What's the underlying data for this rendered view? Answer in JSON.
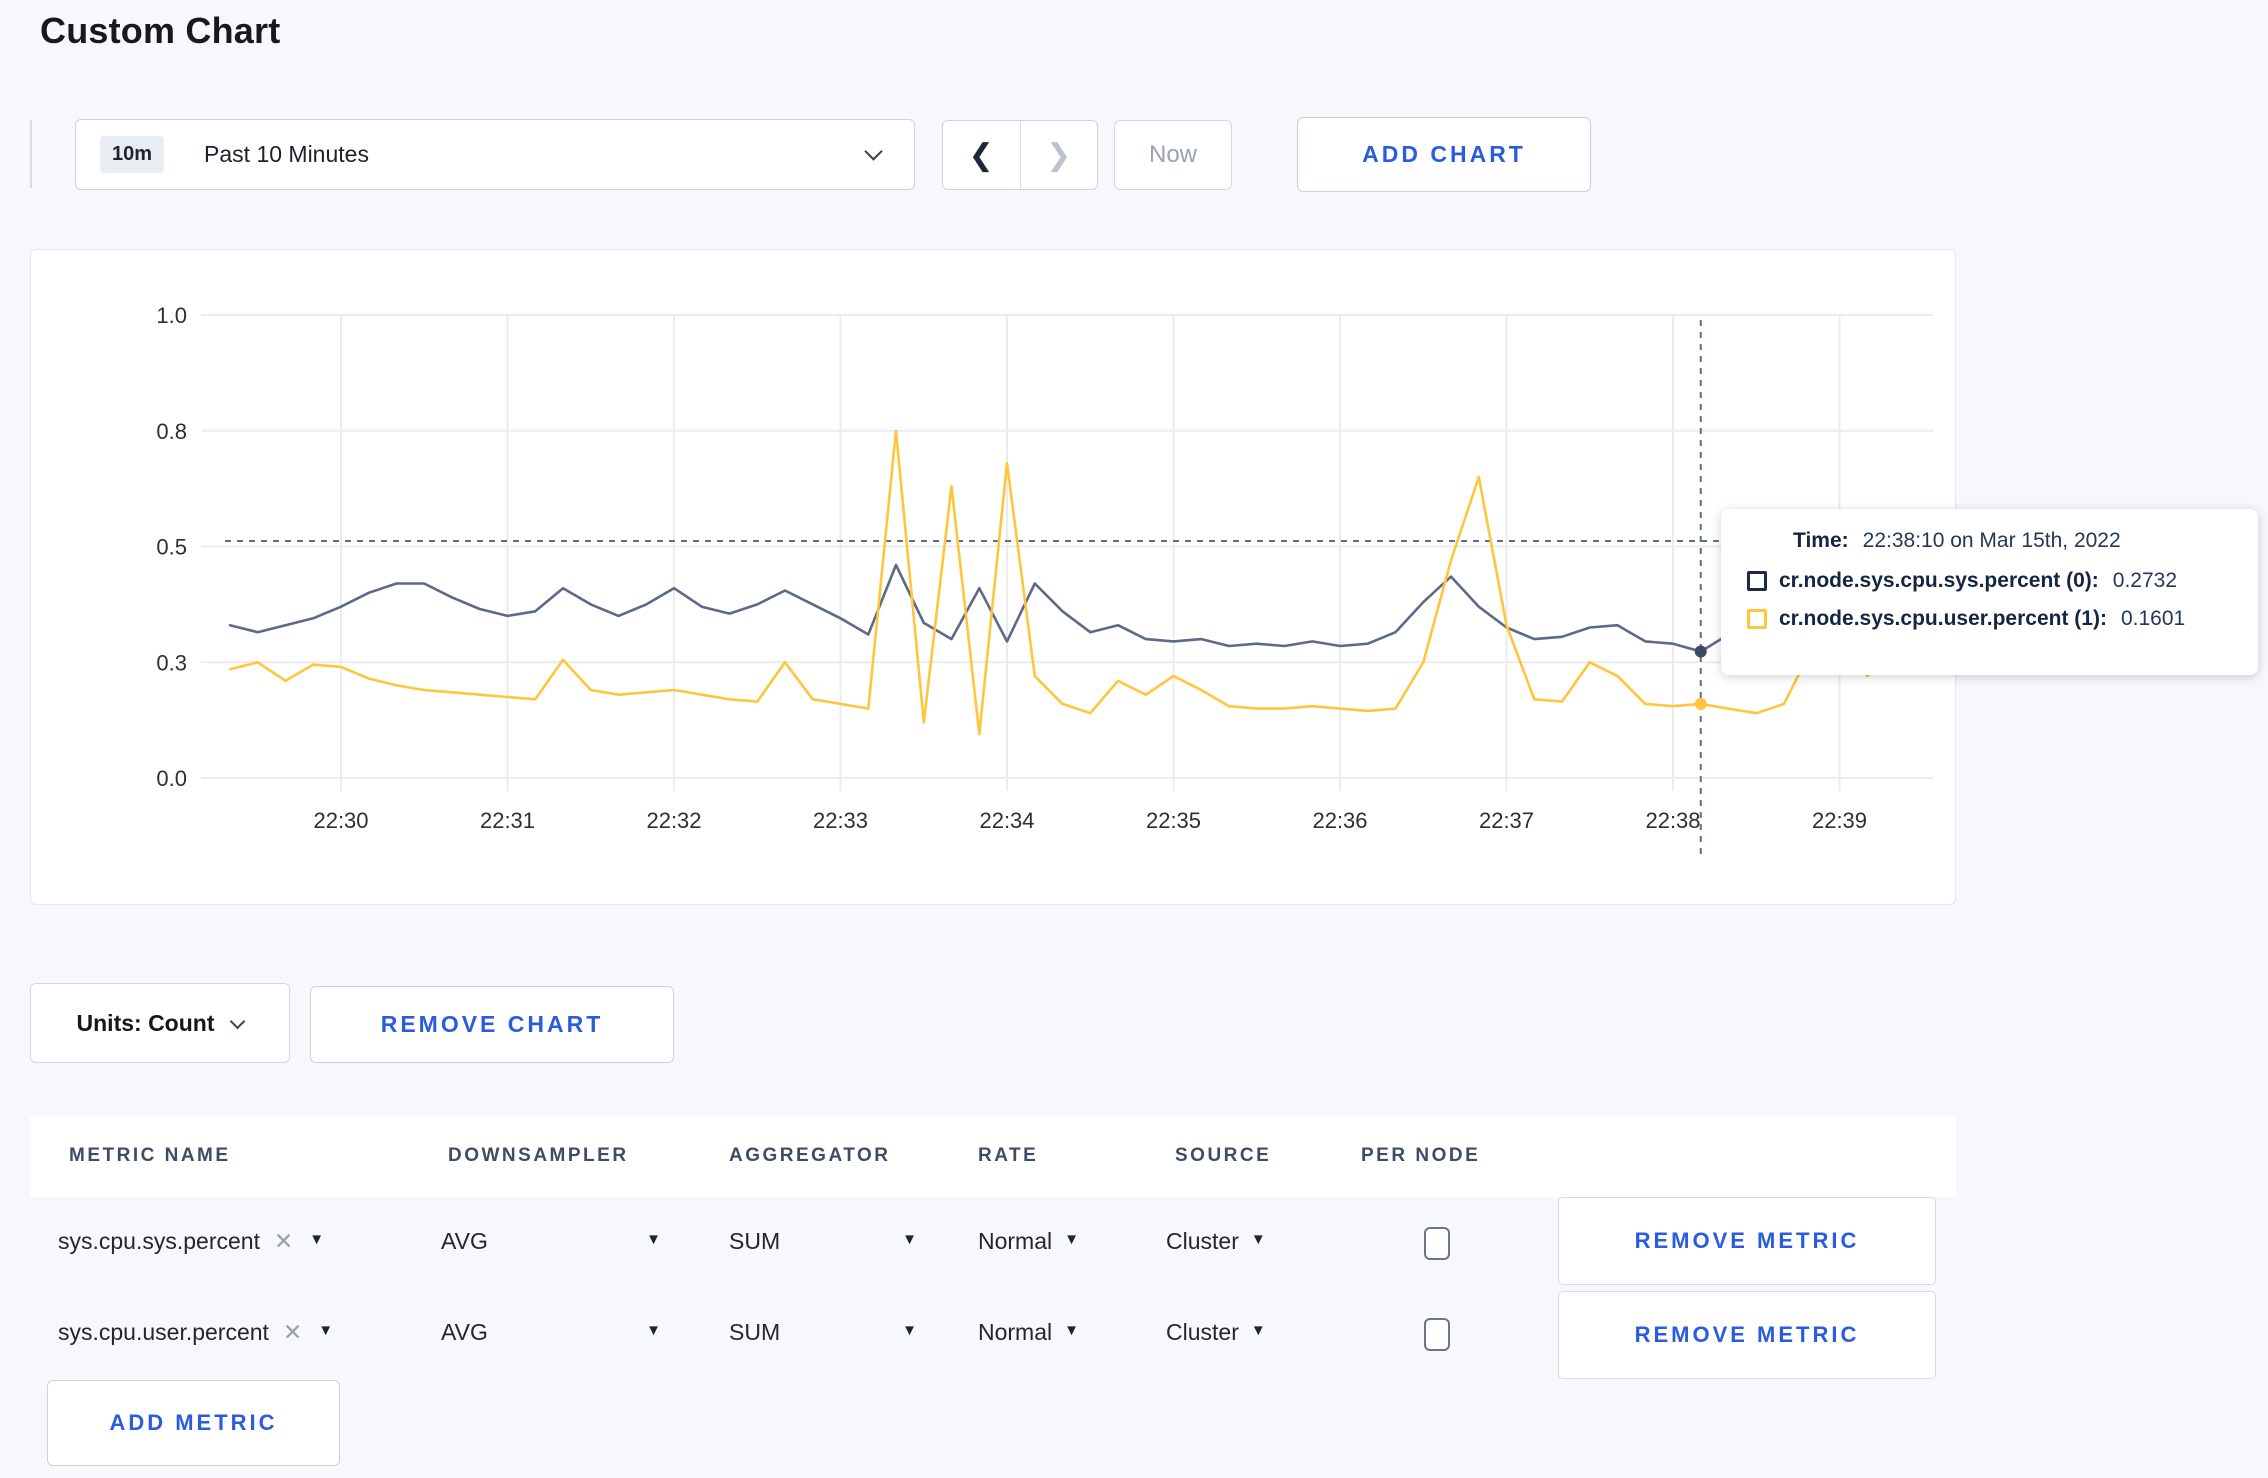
{
  "page": {
    "title": "Custom Chart"
  },
  "toolbar": {
    "range_badge": "10m",
    "range_label": "Past 10 Minutes",
    "now_label": "Now",
    "add_chart_label": "ADD CHART"
  },
  "tooltip": {
    "time_label": "Time:",
    "time_value": "22:38:10 on Mar 15th, 2022",
    "rows": [
      {
        "label": "cr.node.sys.cpu.sys.percent (0):",
        "value": "0.2732",
        "color": "#1b2a4a"
      },
      {
        "label": "cr.node.sys.cpu.user.percent (1):",
        "value": "0.1601",
        "color": "#ffc53c"
      }
    ]
  },
  "chart_footer": {
    "units_label": "Units: Count",
    "remove_chart_label": "REMOVE CHART"
  },
  "metrics_table": {
    "headers": [
      "METRIC NAME",
      "DOWNSAMPLER",
      "AGGREGATOR",
      "RATE",
      "SOURCE",
      "PER NODE"
    ],
    "rows": [
      {
        "metric": "sys.cpu.sys.percent",
        "downsampler": "AVG",
        "aggregator": "SUM",
        "rate": "Normal",
        "source": "Cluster",
        "per_node_checked": false,
        "remove_label": "REMOVE METRIC"
      },
      {
        "metric": "sys.cpu.user.percent",
        "downsampler": "AVG",
        "aggregator": "SUM",
        "rate": "Normal",
        "source": "Cluster",
        "per_node_checked": false,
        "remove_label": "REMOVE METRIC"
      }
    ],
    "add_metric_label": "ADD METRIC"
  },
  "chart_data": {
    "type": "line",
    "title": "",
    "xlabel": "",
    "ylabel": "",
    "ylim": [
      0,
      1
    ],
    "grid": true,
    "legend_position": "none",
    "x_tick_labels": [
      "22:30",
      "22:31",
      "22:32",
      "22:33",
      "22:34",
      "22:35",
      "22:36",
      "22:37",
      "22:38",
      "22:39"
    ],
    "y_ticks": [
      {
        "label": "0.0",
        "value": 0
      },
      {
        "label": "0.3",
        "value": 0.25
      },
      {
        "label": "0.5",
        "value": 0.5
      },
      {
        "label": "0.8",
        "value": 0.75
      },
      {
        "label": "1.0",
        "value": 1
      }
    ],
    "x_start_time": "22:29:20",
    "x_step_seconds": 10,
    "t_start_minutes_from_2230": -0.66667,
    "t_step_minutes": 0.166667,
    "grid_color": "#ececec",
    "axis_text_color": "#2c2f35",
    "crosshair": {
      "time": "22:38:10",
      "t_minutes_from_2230": 8.16667,
      "hline_value": 0.512,
      "color": "#5c7187",
      "point_values": [
        0.2732,
        0.1601
      ],
      "point_colors": [
        "#3e4a63",
        "#ffc53c"
      ]
    },
    "series": [
      {
        "name": "cr.node.sys.cpu.sys.percent (0)",
        "color": "#5c6a87",
        "values": [
          0.33,
          0.315,
          0.33,
          0.345,
          0.37,
          0.4,
          0.42,
          0.42,
          0.39,
          0.365,
          0.35,
          0.36,
          0.41,
          0.375,
          0.35,
          0.375,
          0.41,
          0.37,
          0.355,
          0.375,
          0.405,
          0.375,
          0.345,
          0.31,
          0.46,
          0.335,
          0.3,
          0.41,
          0.295,
          0.42,
          0.36,
          0.315,
          0.33,
          0.3,
          0.295,
          0.3,
          0.285,
          0.29,
          0.285,
          0.295,
          0.285,
          0.29,
          0.315,
          0.38,
          0.435,
          0.37,
          0.325,
          0.3,
          0.305,
          0.325,
          0.33,
          0.295,
          0.29,
          0.2732,
          0.31,
          0.32,
          0.33,
          0.315,
          0.3,
          0.295,
          0.305
        ]
      },
      {
        "name": "cr.node.sys.cpu.user.percent (1)",
        "color": "#ffc53c",
        "values": [
          0.235,
          0.25,
          0.21,
          0.245,
          0.24,
          0.215,
          0.2,
          0.19,
          0.185,
          0.18,
          0.175,
          0.17,
          0.255,
          0.19,
          0.18,
          0.185,
          0.19,
          0.18,
          0.17,
          0.165,
          0.25,
          0.17,
          0.16,
          0.15,
          0.75,
          0.12,
          0.63,
          0.095,
          0.68,
          0.22,
          0.16,
          0.14,
          0.21,
          0.18,
          0.22,
          0.19,
          0.155,
          0.15,
          0.15,
          0.155,
          0.15,
          0.145,
          0.15,
          0.25,
          0.47,
          0.65,
          0.33,
          0.17,
          0.165,
          0.25,
          0.22,
          0.16,
          0.155,
          0.1601,
          0.15,
          0.14,
          0.16,
          0.28,
          0.35,
          0.22,
          0.27
        ]
      }
    ]
  }
}
